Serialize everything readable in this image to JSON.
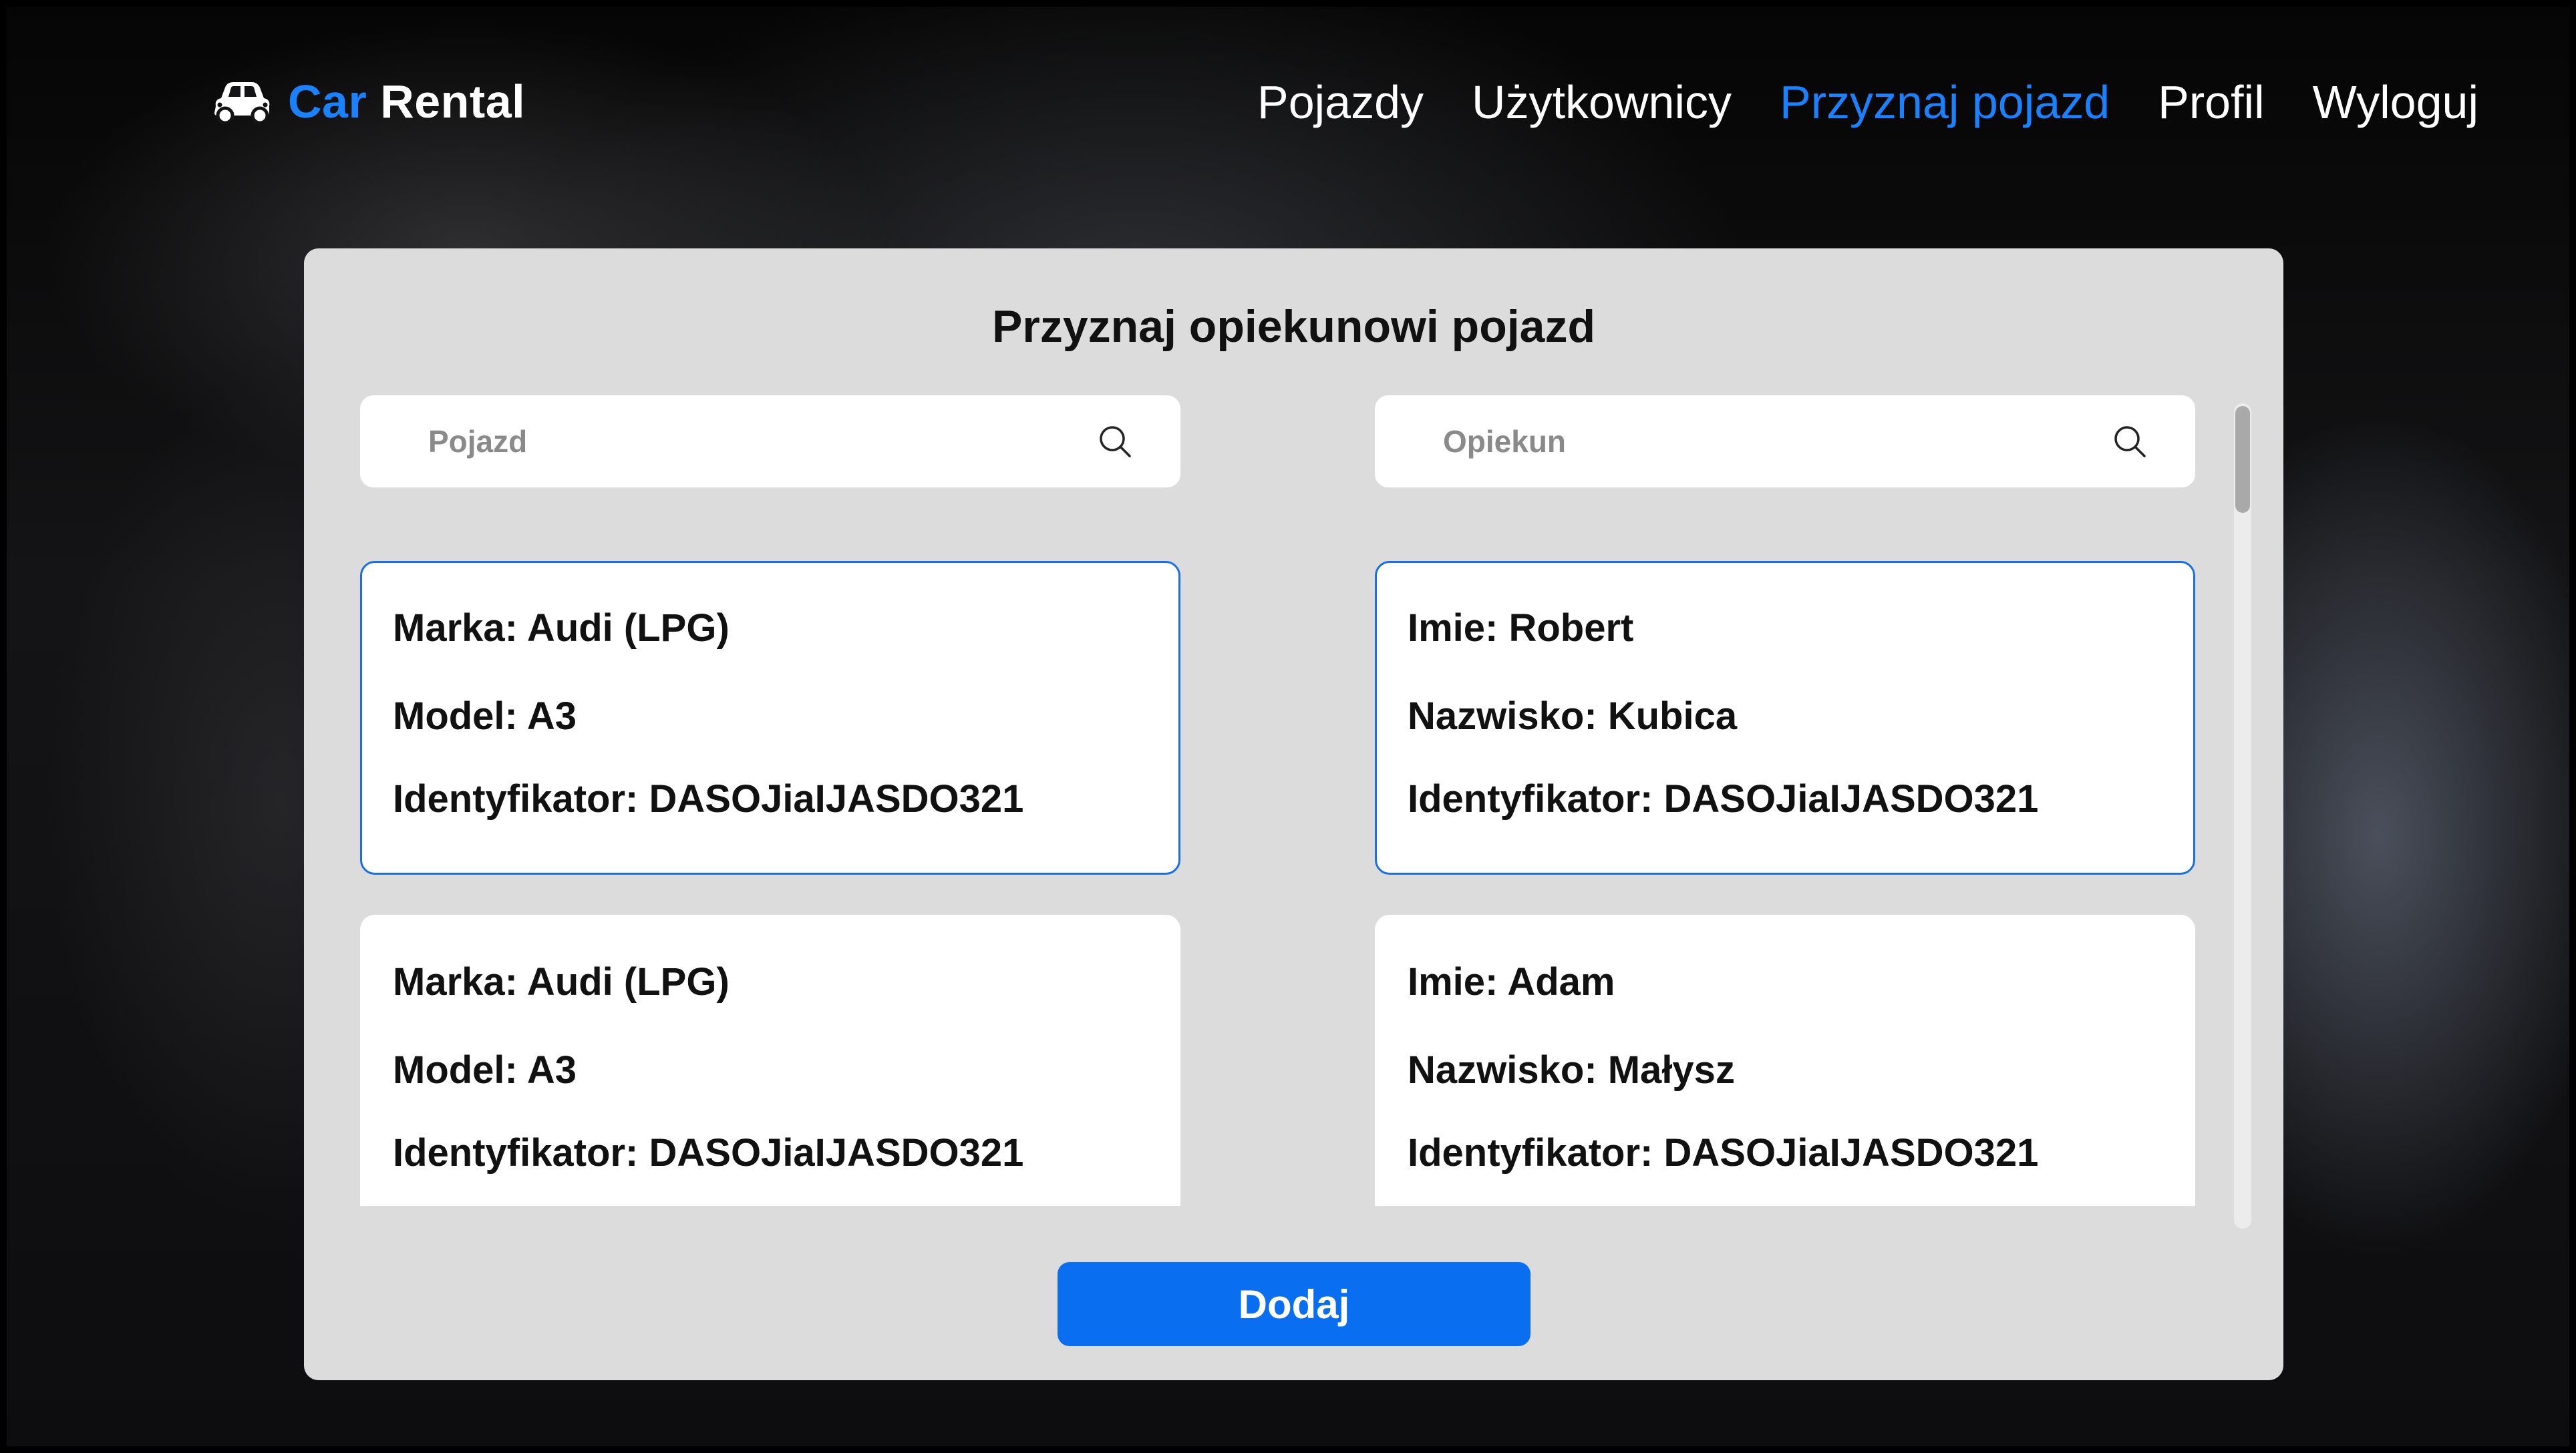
{
  "brand": {
    "part1": "Car",
    "part2": "Rental",
    "icon": "car-icon"
  },
  "nav": {
    "items": [
      {
        "label": "Pojazdy",
        "active": false
      },
      {
        "label": "Użytkownicy",
        "active": false
      },
      {
        "label": "Przyznaj pojazd",
        "active": true
      },
      {
        "label": "Profil",
        "active": false
      },
      {
        "label": "Wyloguj",
        "active": false
      }
    ]
  },
  "panel": {
    "title": "Przyznaj opiekunowi pojazd",
    "vehicle_search": {
      "placeholder": "Pojazd",
      "value": "",
      "icon": "search-icon"
    },
    "caretaker_search": {
      "placeholder": "Opiekun",
      "value": "",
      "icon": "search-icon"
    },
    "vehicles": [
      {
        "brand": "Marka: Audi (LPG)",
        "model": "Model: A3",
        "id": "Identyfikator: DASOJiaIJASDO321",
        "selected": true
      },
      {
        "brand": "Marka: Audi (LPG)",
        "model": "Model: A3",
        "id": "Identyfikator: DASOJiaIJASDO321",
        "selected": false
      }
    ],
    "caretakers": [
      {
        "first_name": "Imie: Robert",
        "last_name": "Nazwisko: Kubica",
        "id": "Identyfikator: DASOJiaIJASDO321",
        "selected": true
      },
      {
        "first_name": "Imie: Adam",
        "last_name": "Nazwisko: Małysz",
        "id": "Identyfikator: DASOJiaIJASDO321",
        "selected": false
      }
    ],
    "add_button": "Dodaj"
  },
  "colors": {
    "accent": "#1a82ff",
    "button": "#0a6ef0",
    "panel": "#dcdcdc",
    "selected_border": "#1a6fe6"
  }
}
